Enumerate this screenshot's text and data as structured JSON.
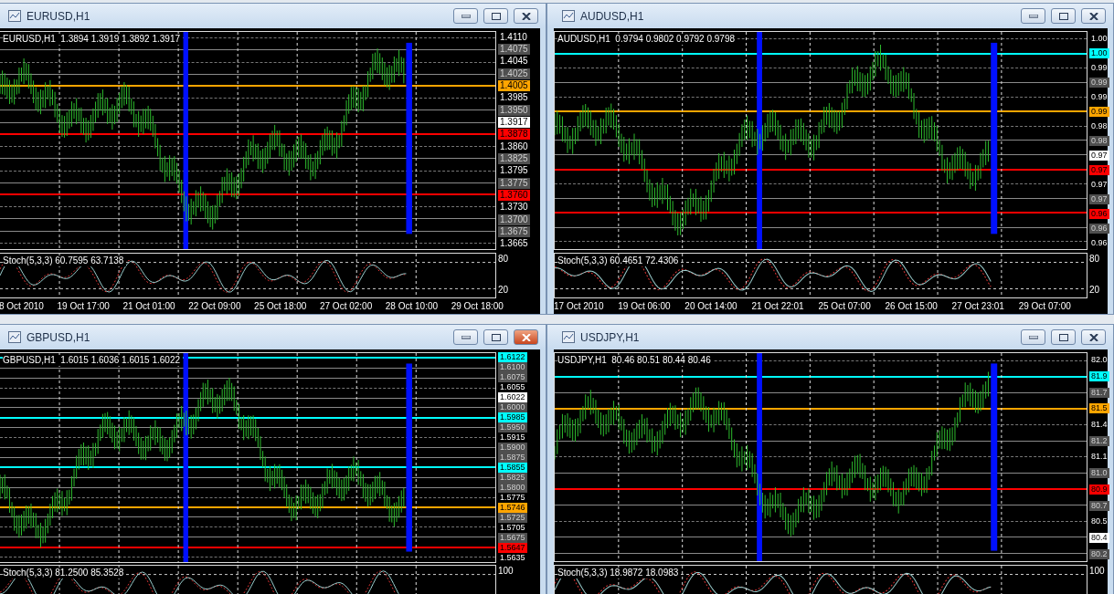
{
  "windows": [
    {
      "title": "EURUSD,H1",
      "active": false,
      "info": "EURUSD,H1  1.3894 1.3919 1.3892 1.3917",
      "price_axis": [
        {
          "text": "1.4110",
          "kind": "grid"
        },
        {
          "text": "1.4075",
          "kind": "line"
        },
        {
          "text": "1.4045",
          "kind": "grid"
        },
        {
          "text": "1.4025",
          "kind": "line"
        },
        {
          "text": "1.4005",
          "kind": "level",
          "color": "#ffa500"
        },
        {
          "text": "1.3985",
          "kind": "grid"
        },
        {
          "text": "1.3950",
          "kind": "line"
        },
        {
          "text": "1.3917",
          "kind": "current"
        },
        {
          "text": "1.3878",
          "kind": "level",
          "color": "#ff0000"
        },
        {
          "text": "1.3860",
          "kind": "grid"
        },
        {
          "text": "1.3825",
          "kind": "line"
        },
        {
          "text": "1.3795",
          "kind": "grid"
        },
        {
          "text": "1.3775",
          "kind": "line"
        },
        {
          "text": "1.3760",
          "kind": "level",
          "color": "#ff0000"
        },
        {
          "text": "1.3730",
          "kind": "grid"
        },
        {
          "text": "1.3700",
          "kind": "line"
        },
        {
          "text": "1.3675",
          "kind": "line"
        },
        {
          "text": "1.3665",
          "kind": "grid"
        }
      ],
      "stochastic": {
        "label": "Stoch(5,3,3) 60.7595 63.7138",
        "scale": [
          "80",
          "20"
        ]
      },
      "time_axis": [
        "8 Oct 2010",
        "19 Oct 17:00",
        "21 Oct 01:00",
        "22 Oct 09:00",
        "25 Oct 18:00",
        "27 Oct 02:00",
        "28 Oct 10:00",
        "29 Oct 18:00"
      ]
    },
    {
      "title": "AUDUSD,H1",
      "active": false,
      "info": "AUDUSD,H1  0.9794 0.9802 0.9792 0.9798",
      "price_axis": [
        {
          "text": "1.00",
          "kind": "grid"
        },
        {
          "text": "1.00",
          "kind": "level",
          "color": "#00ffff"
        },
        {
          "text": "0.99",
          "kind": "grid"
        },
        {
          "text": "0.99",
          "kind": "line"
        },
        {
          "text": "0.99",
          "kind": "grid"
        },
        {
          "text": "0.99",
          "kind": "level",
          "color": "#ffa500"
        },
        {
          "text": "0.98",
          "kind": "grid"
        },
        {
          "text": "0.98",
          "kind": "line"
        },
        {
          "text": "0.97",
          "kind": "current"
        },
        {
          "text": "0.97",
          "kind": "level",
          "color": "#ff0000"
        },
        {
          "text": "0.97",
          "kind": "grid"
        },
        {
          "text": "0.97",
          "kind": "line"
        },
        {
          "text": "0.96",
          "kind": "level",
          "color": "#ff0000"
        },
        {
          "text": "0.96",
          "kind": "line"
        },
        {
          "text": "0.96",
          "kind": "grid"
        }
      ],
      "stochastic": {
        "label": "Stoch(5,3,3) 60.4651 72.4306",
        "scale": [
          "80",
          "20"
        ]
      },
      "time_axis": [
        "17 Oct 2010",
        "19 Oct 06:00",
        "20 Oct 14:00",
        "21 Oct 22:01",
        "25 Oct 07:00",
        "26 Oct 15:00",
        "27 Oct 23:01",
        "29 Oct 07:00"
      ]
    },
    {
      "title": "GBPUSD,H1",
      "active": true,
      "info": "GBPUSD,H1  1.6015 1.6036 1.6015 1.6022",
      "price_axis": [
        {
          "text": "1.6122",
          "kind": "level",
          "color": "#00ffff"
        },
        {
          "text": "1.6100",
          "kind": "line"
        },
        {
          "text": "1.6075",
          "kind": "line"
        },
        {
          "text": "1.6055",
          "kind": "grid"
        },
        {
          "text": "1.6022",
          "kind": "current"
        },
        {
          "text": "1.6000",
          "kind": "line"
        },
        {
          "text": "1.5985",
          "kind": "level",
          "color": "#00ffff"
        },
        {
          "text": "1.5950",
          "kind": "line"
        },
        {
          "text": "1.5915",
          "kind": "grid"
        },
        {
          "text": "1.5900",
          "kind": "line"
        },
        {
          "text": "1.5875",
          "kind": "line"
        },
        {
          "text": "1.5855",
          "kind": "level",
          "color": "#00ffff"
        },
        {
          "text": "1.5825",
          "kind": "line"
        },
        {
          "text": "1.5800",
          "kind": "line"
        },
        {
          "text": "1.5775",
          "kind": "grid"
        },
        {
          "text": "1.5746",
          "kind": "level",
          "color": "#ffa500"
        },
        {
          "text": "1.5725",
          "kind": "line"
        },
        {
          "text": "1.5705",
          "kind": "grid"
        },
        {
          "text": "1.5675",
          "kind": "line"
        },
        {
          "text": "1.5647",
          "kind": "level",
          "color": "#ff0000"
        },
        {
          "text": "1.5635",
          "kind": "grid"
        }
      ],
      "stochastic": {
        "label": "Stoch(5,3,3) 81.2500 85.3528",
        "scale": [
          "100"
        ]
      }
    },
    {
      "title": "USDJPY,H1",
      "active": false,
      "info": "USDJPY,H1  80.46 80.51 80.44 80.46",
      "price_axis": [
        {
          "text": "82.0",
          "kind": "grid"
        },
        {
          "text": "81.9",
          "kind": "level",
          "color": "#00ffff"
        },
        {
          "text": "81.7",
          "kind": "line"
        },
        {
          "text": "81.5",
          "kind": "level",
          "color": "#ffa500"
        },
        {
          "text": "81.4",
          "kind": "grid"
        },
        {
          "text": "81.2",
          "kind": "line"
        },
        {
          "text": "81.1",
          "kind": "grid"
        },
        {
          "text": "81.0",
          "kind": "line"
        },
        {
          "text": "80.9",
          "kind": "level",
          "color": "#ff0000"
        },
        {
          "text": "80.7",
          "kind": "line"
        },
        {
          "text": "80.5",
          "kind": "grid"
        },
        {
          "text": "80.4",
          "kind": "current"
        },
        {
          "text": "80.2",
          "kind": "line"
        }
      ],
      "stochastic": {
        "label": "Stoch(5,3,3) 18.9872 18.0983",
        "scale": [
          "100"
        ]
      }
    }
  ]
}
